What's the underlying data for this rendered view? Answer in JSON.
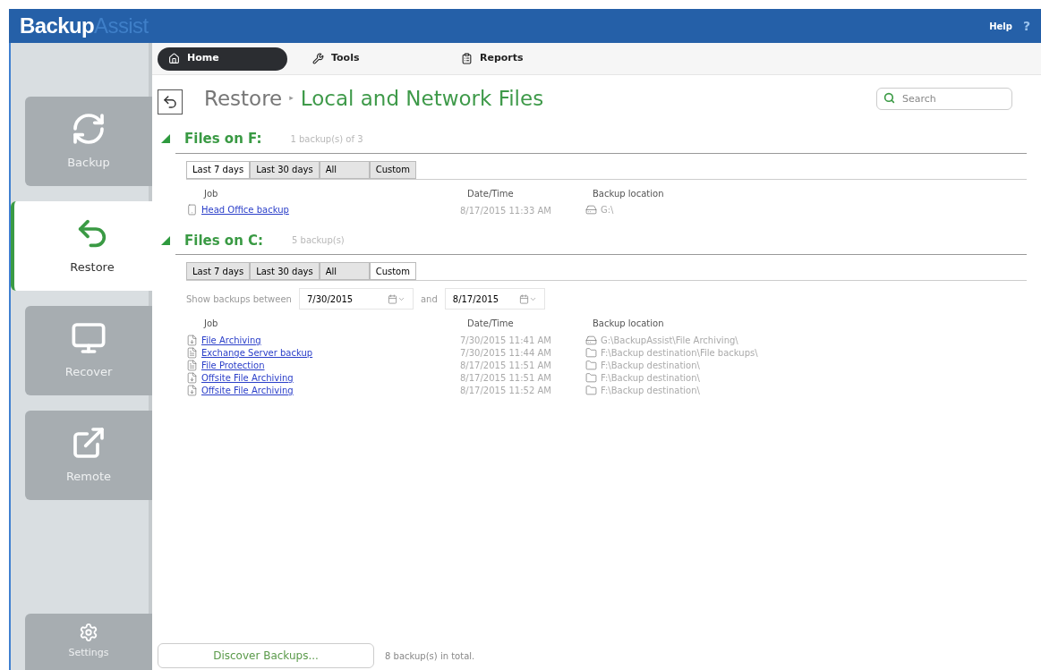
{
  "header": {
    "logo_main": "Backup",
    "logo_accent": "Assist",
    "help": "Help",
    "help_icon": "?"
  },
  "sidebar": {
    "items": [
      {
        "label": "Backup",
        "kind": "backup",
        "selected": false
      },
      {
        "label": "Restore",
        "kind": "restore",
        "selected": true
      },
      {
        "label": "Recover",
        "kind": "recover",
        "selected": false
      },
      {
        "label": "Remote",
        "kind": "remote",
        "selected": false
      }
    ],
    "settings": {
      "label": "Settings"
    }
  },
  "nav": [
    {
      "label": "Home",
      "kind": "home",
      "selected": true
    },
    {
      "label": "Tools",
      "kind": "tools",
      "selected": false
    },
    {
      "label": "Reports",
      "kind": "reports",
      "selected": false
    }
  ],
  "breadcrumb": {
    "parent": "Restore",
    "separator": "▸",
    "current": "Local and Network Files"
  },
  "search": {
    "placeholder": "Search"
  },
  "sections": [
    {
      "title": "Files on F:",
      "count": "1 backup(s) of 3",
      "expanded": true,
      "tabs": [
        {
          "label": "Last 7 days",
          "selected": true
        },
        {
          "label": "Last 30 days",
          "selected": false
        },
        {
          "label": "All",
          "selected": false
        },
        {
          "label": "Custom",
          "selected": false
        }
      ],
      "columns": [
        "Job",
        "Date/Time",
        "Backup location"
      ],
      "rows": [
        {
          "kind": "devices",
          "job": "Head Office backup",
          "date": "8/17/2015 11:33 AM",
          "location": {
            "kind": "drive",
            "path": "G:\\"
          }
        }
      ]
    },
    {
      "title": "Files on C:",
      "count": "5 backup(s)",
      "expanded": true,
      "tabs": [
        {
          "label": "Last 7 days",
          "selected": false
        },
        {
          "label": "Last 30 days",
          "selected": false
        },
        {
          "label": "All",
          "selected": false
        },
        {
          "label": "Custom",
          "selected": true
        }
      ],
      "date_filter": {
        "label": "Show backups between",
        "from": "7/30/2015",
        "joiner": "and",
        "to": "8/17/2015"
      },
      "columns": [
        "Job",
        "Date/Time",
        "Backup location"
      ],
      "rows": [
        {
          "kind": "archive",
          "job": "File Archiving",
          "date": "7/30/2015 11:41 AM",
          "location": {
            "kind": "drive",
            "path": "G:\\BackupAssist\\File Archiving\\"
          }
        },
        {
          "kind": "page",
          "job": "Exchange Server backup",
          "date": "7/30/2015 11:44 AM",
          "location": {
            "kind": "folder",
            "path": "F:\\Backup destination\\File backups\\"
          }
        },
        {
          "kind": "page",
          "job": "File Protection",
          "date": "8/17/2015 11:51 AM",
          "location": {
            "kind": "folder",
            "path": "F:\\Backup destination\\"
          }
        },
        {
          "kind": "archive",
          "job": "Offsite File Archiving",
          "date": "8/17/2015 11:51 AM",
          "location": {
            "kind": "folder",
            "path": "F:\\Backup destination\\"
          }
        },
        {
          "kind": "archive",
          "job": "Offsite File Archiving",
          "date": "8/17/2015 11:52 AM",
          "location": {
            "kind": "folder",
            "path": "F:\\Backup destination\\"
          }
        }
      ]
    }
  ],
  "footer": {
    "button": "Discover Backups...",
    "total": "8 backup(s) in total."
  }
}
